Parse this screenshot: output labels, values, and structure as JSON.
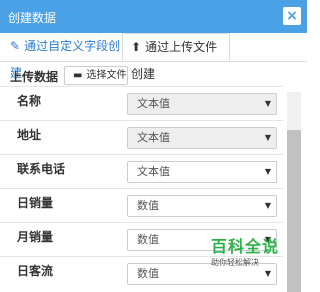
{
  "window": {
    "title": "创建数据",
    "close_icon": "×"
  },
  "tabs": [
    {
      "label": "通过自定义字段创建",
      "icon": "pencil-icon"
    },
    {
      "label": "通过上传文件创建",
      "icon": "upload-icon"
    }
  ],
  "upload": {
    "label": "上传数据",
    "button_label": "选择文件",
    "button_icon": "folder-icon"
  },
  "fields": [
    {
      "label": "名称",
      "value": "文本值",
      "disabled": true
    },
    {
      "label": "地址",
      "value": "文本值",
      "disabled": true
    },
    {
      "label": "联系电话",
      "value": "文本值",
      "disabled": false
    },
    {
      "label": "日销量",
      "value": "数值",
      "disabled": false
    },
    {
      "label": "月销量",
      "value": "数值",
      "disabled": false
    },
    {
      "label": "日客流",
      "value": "数值",
      "disabled": false
    }
  ],
  "watermark": {
    "logo": "百科全说",
    "sub": "助你轻松解决"
  },
  "colors": {
    "titlebar": "#4aa1e6",
    "active_tab_text": "#2a7bd0",
    "watermark": "#2fb24a"
  }
}
